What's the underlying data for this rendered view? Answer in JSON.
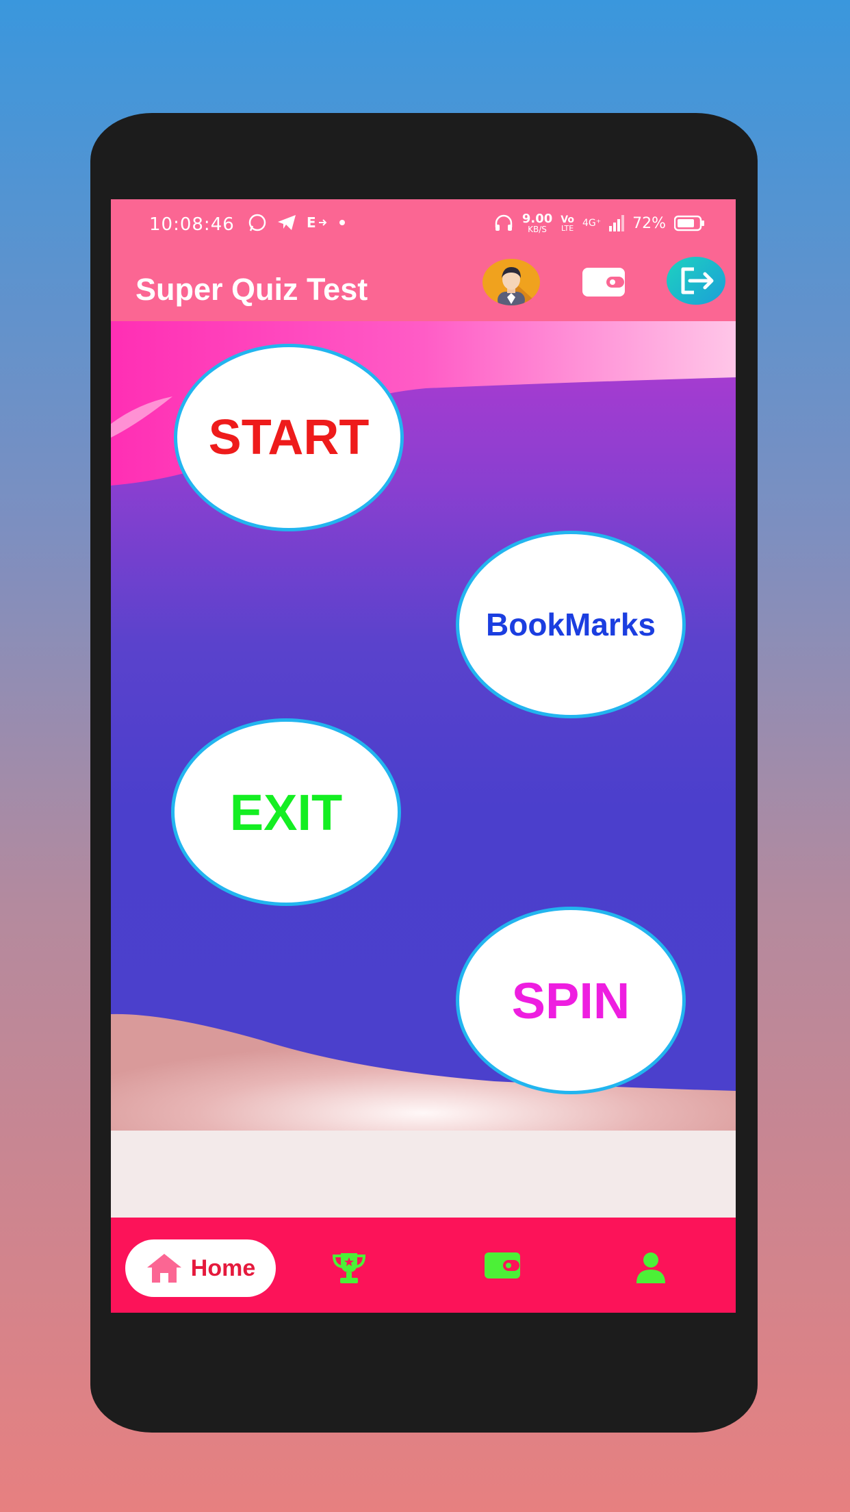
{
  "status_bar": {
    "time": "10:08:46",
    "net_speed_value": "9.00",
    "net_speed_unit": "KB/S",
    "volte_top": "Vo",
    "volte_bottom": "LTE",
    "network": "4G⁺",
    "battery": "72%"
  },
  "app_bar": {
    "title": "Super Quiz Test"
  },
  "menu": {
    "start": "START",
    "bookmarks": "BookMarks",
    "exit": "EXIT",
    "spin": "SPIN"
  },
  "bottom_nav": {
    "home_label": "Home",
    "items": [
      "home-icon",
      "trophy-icon",
      "wallet-icon",
      "profile-icon"
    ],
    "active_color": "#fc1359",
    "icon_color": "#4cf037"
  },
  "colors": {
    "app_bar": "#fb6693",
    "main_bg": "#4b40cc",
    "bubble_border": "#22b5ef"
  }
}
